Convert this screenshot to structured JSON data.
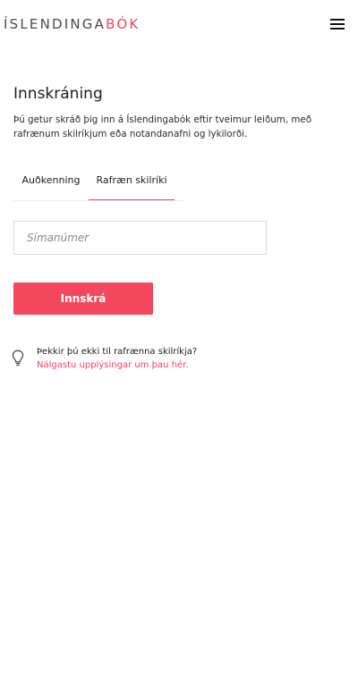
{
  "header": {
    "logo_main": "ÍSLENDINGA",
    "logo_accent": "BÓK",
    "menu_icon": "hamburger-menu-icon"
  },
  "login": {
    "title": "Innskráning",
    "intro": "Þú getur skráð þig inn á Íslendingabók eftir tveimur leiðum, með rafrænum skilríkjum eða notandanafni og lykilorði.",
    "tabs": [
      {
        "label": "Auðkenning",
        "active": false
      },
      {
        "label": "Rafræn skilríki",
        "active": true
      }
    ],
    "phone": {
      "placeholder": "Símanúmer",
      "value": ""
    },
    "submit_label": "Innskrá"
  },
  "hint": {
    "icon": "lightbulb-icon",
    "question": "Þekkir þú ekki til rafrænna skilríkja?",
    "link": "Nálgastu upplýsingar um þau hér."
  },
  "colors": {
    "accent": "#f0445a",
    "button": "#f3475d"
  }
}
